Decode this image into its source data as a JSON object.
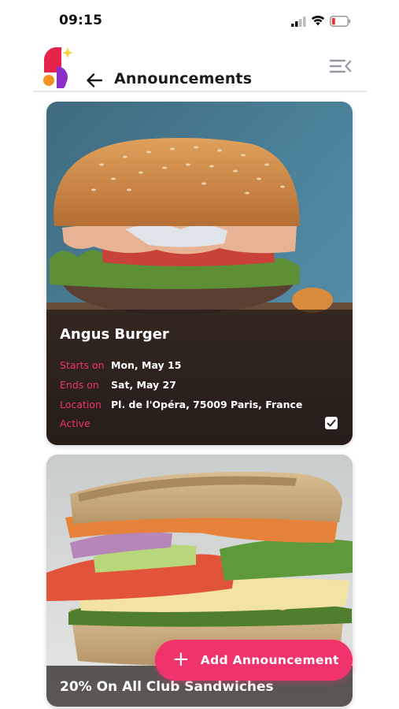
{
  "status_bar": {
    "time": "09:15",
    "icons": [
      "cellular-signal-icon",
      "wifi-icon",
      "battery-low-icon"
    ]
  },
  "header": {
    "title": "Announcements",
    "back_icon": "arrow-left-icon",
    "menu_icon": "menu-collapse-icon",
    "logo_icon": "app-logo-s-icon"
  },
  "colors": {
    "accent": "#f0336b",
    "logo_red": "#e8234a",
    "logo_purple": "#8b2fc9",
    "logo_orange": "#f39220",
    "logo_star": "#f6d332"
  },
  "announcements": [
    {
      "name": "Angus Burger",
      "starts_label": "Starts on",
      "starts_value": "Mon, May 15",
      "ends_label": "Ends on",
      "ends_value": "Sat, May 27",
      "location_label": "Location",
      "location_value": "Pl. de l'Opéra, 75009 Paris, France",
      "status_label": "Active",
      "active": true
    },
    {
      "name": "20% On All Club Sandwiches"
    }
  ],
  "fab": {
    "label": "Add Announcement",
    "icon": "plus-icon"
  }
}
